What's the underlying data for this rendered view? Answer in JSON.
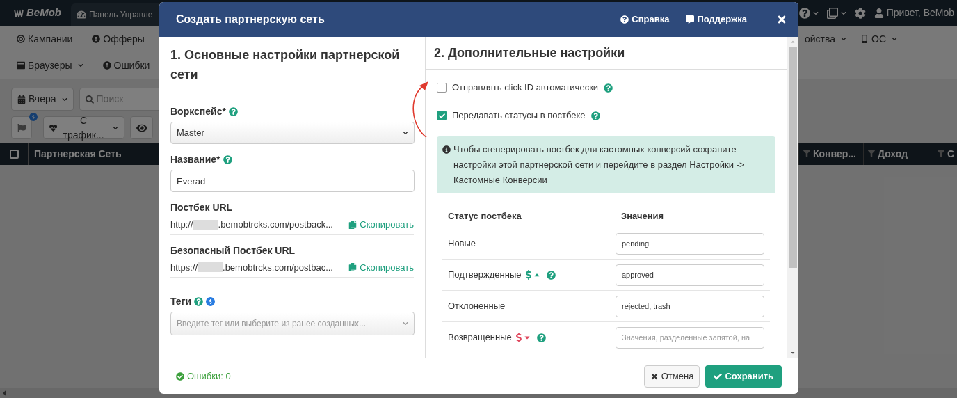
{
  "app": {
    "logo": "BeMob",
    "tab": "Панель Управле",
    "user": "Привет, BeMob",
    "nav_left": [
      {
        "label": "Кампании",
        "dropdown": false
      },
      {
        "label": "Офферы",
        "dropdown": false
      }
    ],
    "nav_right": [
      {
        "label": "ойства",
        "dropdown": true
      },
      {
        "label": "ОС",
        "dropdown": true
      }
    ],
    "nav_row2": [
      {
        "label": "Браузеры",
        "dropdown": true
      },
      {
        "label": "Ошибки",
        "dropdown": false
      }
    ],
    "date": "Вчера",
    "search_placeholder": "Поиск",
    "traffic_filter": "С трафик...",
    "select_all_checked": false,
    "columns_left": [
      "Партнерская Сеть"
    ],
    "columns_right": [
      "Конвер...",
      "Доход",
      "С"
    ]
  },
  "modal": {
    "title": "Создать партнерскую сеть",
    "help": "Справка",
    "support": "Поддержка",
    "section1": {
      "title": "1. Основные настройки партнерской сети",
      "workspace": {
        "label": "Воркспейс*",
        "value": "Master"
      },
      "name": {
        "label": "Название*",
        "value": "Everad"
      },
      "urls": [
        {
          "label": "Постбек URL",
          "prefix": "http://",
          "rest": ".bemobtrcks.com/postback...",
          "copy": "Скопировать"
        },
        {
          "label": "Безопасный Постбек URL",
          "prefix": "https://",
          "rest": ".bemobtrcks.com/postbac...",
          "copy": "Скопировать"
        }
      ],
      "tags": {
        "label": "Теги",
        "placeholder": "Введите тег или выберите из ранее созданных..."
      }
    },
    "section2": {
      "title": "2. Дополнительные настройки",
      "options": [
        {
          "label": "Отправлять click ID автоматически",
          "checked": false
        },
        {
          "label": "Передавать статусы в постбеке",
          "checked": true
        }
      ],
      "info": "Чтобы сгенерировать постбек для кастомных конверсий сохраните настройки этой партнерской сети и перейдите в раздел Настройки -> Кастомные Конверсии",
      "table": {
        "columns": [
          "Статус постбека",
          "Значения"
        ],
        "rows": [
          {
            "kind": "plain",
            "label": "Новые",
            "value": "pending"
          },
          {
            "kind": "revenue_up",
            "label": "Подтвержденные",
            "value": "approved"
          },
          {
            "kind": "plain",
            "label": "Отклоненные",
            "value": "rejected, trash"
          },
          {
            "kind": "revenue_down",
            "label": "Возвращенные",
            "placeholder": "Значения, разделенные запятой, на"
          }
        ]
      }
    },
    "errors": "Ошибки: 0",
    "cancel": "Отмена",
    "save": "Сохранить"
  }
}
